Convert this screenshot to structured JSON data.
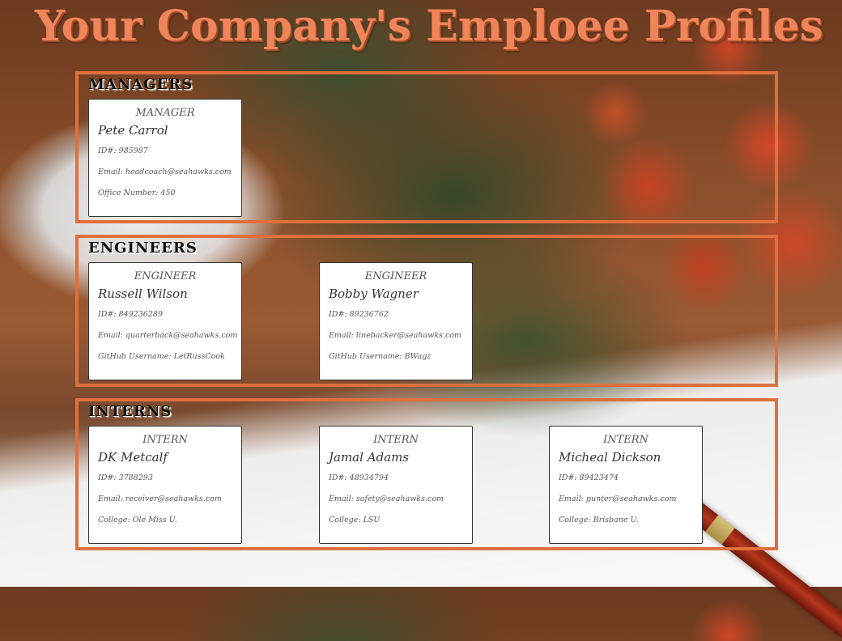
{
  "page_title": "Your Company's Emploee Profiles",
  "colors": {
    "accent": "#e06f3d",
    "title": "#f0845a",
    "card_background": "#ffffff"
  },
  "sections": {
    "managers": {
      "title": "MANAGERS",
      "cards": [
        {
          "role": "MANAGER",
          "name": "Pete Carrol",
          "id": "ID#: 985987",
          "email": "Email: headcoach@seahawks.com",
          "extra": "Office Number: 450"
        }
      ]
    },
    "engineers": {
      "title": "ENGINEERS",
      "cards": [
        {
          "role": "ENGINEER",
          "name": "Russell Wilson",
          "id": "ID#: 849236289",
          "email": "Email: quarterback@seahawks.com",
          "extra": "GitHub Username: LetRussCook"
        },
        {
          "role": "ENGINEER",
          "name": "Bobby Wagner",
          "id": "ID#: 89236762",
          "email": "Email: linebacker@seahawks.com",
          "extra": "GitHub Username: BWagz"
        }
      ]
    },
    "interns": {
      "title": "INTERNS",
      "cards": [
        {
          "role": "INTERN",
          "name": "DK Metcalf",
          "id": "ID#: 3788293",
          "email": "Email: receiver@seahawks.com",
          "extra": "College: Ole Miss U."
        },
        {
          "role": "INTERN",
          "name": "Jamal Adams",
          "id": "ID#: 48934794",
          "email": "Email: safety@seahawks.com",
          "extra": "College: LSU"
        },
        {
          "role": "INTERN",
          "name": "Micheal Dickson",
          "id": "ID#: 89423474",
          "email": "Email: punter@seahawks.com",
          "extra": "College: Brisbane U."
        }
      ]
    }
  }
}
